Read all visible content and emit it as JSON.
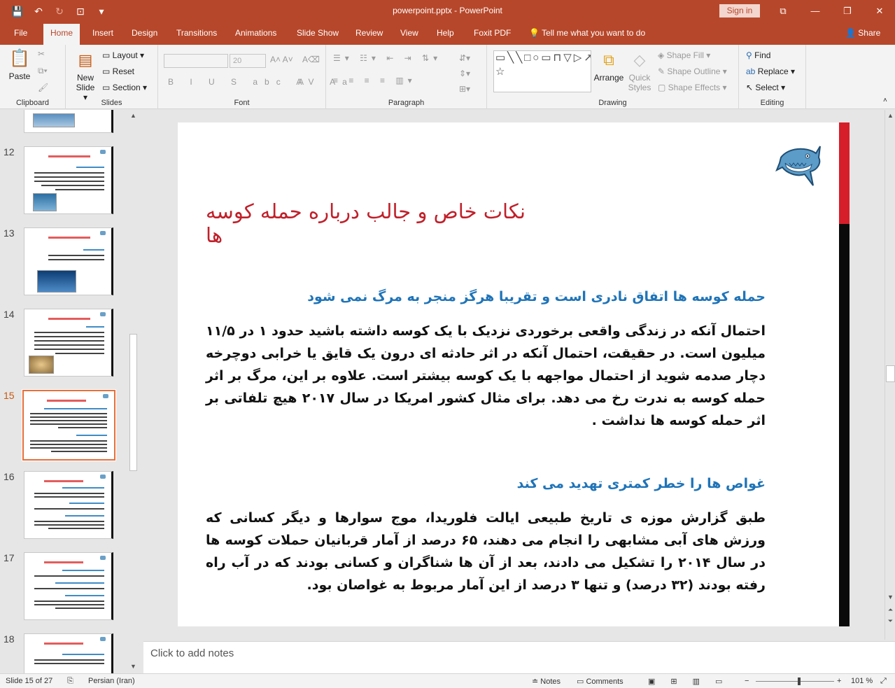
{
  "window": {
    "title": "powerpoint.pptx  -  PowerPoint",
    "sign_in": "Sign in",
    "controls": {
      "restore_glyph": "⧉",
      "minimize_glyph": "—",
      "maximize_glyph": "❐",
      "close_glyph": "✕"
    }
  },
  "qat": {
    "save_icon": "💾",
    "undo_icon": "↶",
    "redo_icon": "↻",
    "present_icon": "⊡",
    "customize_icon": "▾"
  },
  "tabs": [
    "File",
    "Home",
    "Insert",
    "Design",
    "Transitions",
    "Animations",
    "Slide Show",
    "Review",
    "View",
    "Help",
    "Foxit PDF"
  ],
  "tell_me": "Tell me what you want to do",
  "share": "Share",
  "ribbon": {
    "clipboard": {
      "label": "Clipboard",
      "paste": "Paste"
    },
    "slides": {
      "label": "Slides",
      "new_slide_line1": "New",
      "new_slide_line2": "Slide",
      "layout": "Layout",
      "reset": "Reset",
      "section": "Section"
    },
    "font": {
      "label": "Font",
      "font_name": "",
      "font_size": "20",
      "format_row": "B I U S abc AV Aa",
      "color_row": "A"
    },
    "paragraph": {
      "label": "Paragraph"
    },
    "drawing": {
      "label": "Drawing",
      "arrange": "Arrange",
      "quick_styles_1": "Quick",
      "quick_styles_2": "Styles",
      "shape_fill": "Shape Fill",
      "shape_outline": "Shape Outline",
      "shape_effects": "Shape Effects"
    },
    "editing": {
      "label": "Editing",
      "find": "Find",
      "replace": "Replace",
      "select": "Select"
    }
  },
  "thumbnails": [
    {
      "num": "12",
      "current": false
    },
    {
      "num": "13",
      "current": false
    },
    {
      "num": "14",
      "current": false
    },
    {
      "num": "15",
      "current": true
    },
    {
      "num": "16",
      "current": false
    },
    {
      "num": "17",
      "current": false
    },
    {
      "num": "18",
      "current": false
    }
  ],
  "slide": {
    "title": "نکات خاص و جالب درباره حمله کوسه ها",
    "heading1": "حمله کوسه ها اتفاق نادری است و تقریبا هرگز منجر به مرگ نمی شود",
    "body1": "احتمال آنکه در زندگی واقعی برخوردی نزدیک با یک کوسه داشته باشید حدود ۱ در ۱۱/۵ میلیون است. در حقیقت، احتمال آنکه در اثر حادثه ای درون یک قایق یا خرابی دوچرخه دچار صدمه شوید از احتمال مواجهه با یک کوسه بیشتر است. علاوه بر این، مرگ بر اثر حمله کوسه به ندرت رخ می دهد. برای مثال کشور امریکا در سال ۲۰۱۷ هیچ تلفاتی بر اثر حمله کوسه ها نداشت .",
    "heading2": "غواص ها را خطر کمتری تهدید می کند",
    "body2": "طبق گزارش موزه ی تاریخ طبیعی ایالت فلوریدا، موج سوارها و دیگر کسانی که ورزش های آبی مشابهی را انجام می دهند، ۶۵ درصد از آمار قربانیان حملات کوسه ها در سال ۲۰۱۴ را تشکیل می دادند، بعد از آن ها شناگران و کسانی بودند که در آب راه رفته بودند (۳۲ درصد) و تنها ۳ درصد از این آمار مربوط به غواصان بود."
  },
  "notes": {
    "placeholder": "Click to add notes"
  },
  "status": {
    "slide_info": "Slide 15 of 27",
    "language": "Persian (Iran)",
    "notes": "Notes",
    "comments": "Comments",
    "zoom": "101 %"
  },
  "colors": {
    "accent": "#b7472a",
    "slide_title": "#c0202a",
    "slide_heading": "#1f74b8",
    "side_bar_red": "#d51e2a"
  }
}
